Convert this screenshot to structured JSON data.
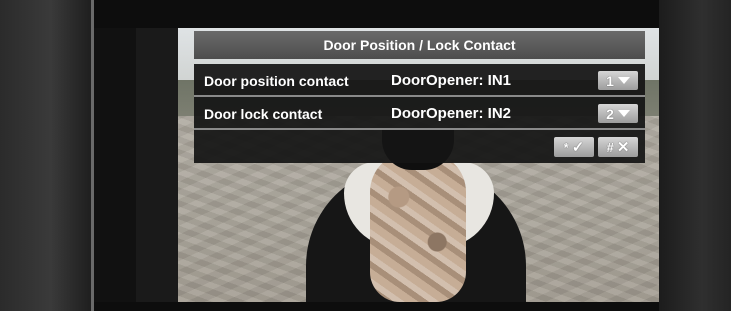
{
  "dialog": {
    "title": "Door Position / Lock Contact",
    "rows": [
      {
        "label": "Door position contact",
        "value": "DoorOpener: IN1",
        "key": "1"
      },
      {
        "label": "Door lock contact",
        "value": "DoorOpener: IN2",
        "key": "2"
      }
    ],
    "actions": {
      "confirm": {
        "key": "*",
        "glyph": "✓",
        "icon": "checkmark-icon"
      },
      "cancel": {
        "key": "#",
        "glyph": "✕",
        "icon": "close-icon"
      }
    }
  },
  "colors": {
    "title_bar": "#5a5a5a",
    "row_background": "#141414",
    "button": "#b8b8b8",
    "text": "#ffffff"
  }
}
